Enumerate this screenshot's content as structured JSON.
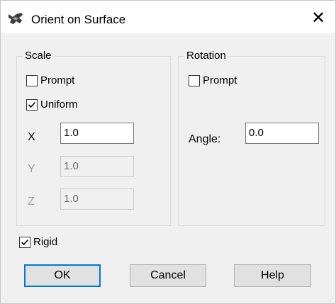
{
  "window": {
    "title": "Orient on Surface",
    "icon": "rhino-app-icon",
    "close_glyph": "✕"
  },
  "scale_group": {
    "title": "Scale",
    "prompt": {
      "label": "Prompt",
      "checked": false
    },
    "uniform": {
      "label": "Uniform",
      "checked": true
    },
    "x": {
      "label": "X",
      "value": "1.0"
    },
    "y": {
      "label": "Y",
      "value": "1.0",
      "enabled": false
    },
    "z": {
      "label": "Z",
      "value": "1.0",
      "enabled": false
    }
  },
  "rotation_group": {
    "title": "Rotation",
    "prompt": {
      "label": "Prompt",
      "checked": false
    },
    "angle": {
      "label": "Angle:",
      "value": "0.0"
    }
  },
  "rigid": {
    "label": "Rigid",
    "checked": true
  },
  "buttons": {
    "ok": "OK",
    "cancel": "Cancel",
    "help": "Help"
  },
  "colors": {
    "accent": "#0078d7",
    "dialog_bg": "#f0f0f0",
    "titlebar_bg": "#ffffff"
  }
}
